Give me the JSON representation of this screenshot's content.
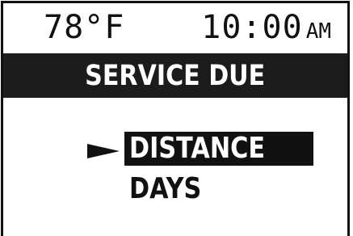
{
  "status": {
    "temperature": "78°F",
    "time": "10:00",
    "ampm": "AM"
  },
  "screen": {
    "title": "SERVICE DUE"
  },
  "menu": {
    "items": [
      {
        "label": "DISTANCE",
        "selected": true
      },
      {
        "label": "DAYS",
        "selected": false
      }
    ],
    "pointer_icon": "selection-arrow-icon"
  },
  "colors": {
    "foreground": "#111111",
    "background": "#ffffff",
    "highlight_bg": "#111111",
    "highlight_fg": "#ffffff"
  }
}
